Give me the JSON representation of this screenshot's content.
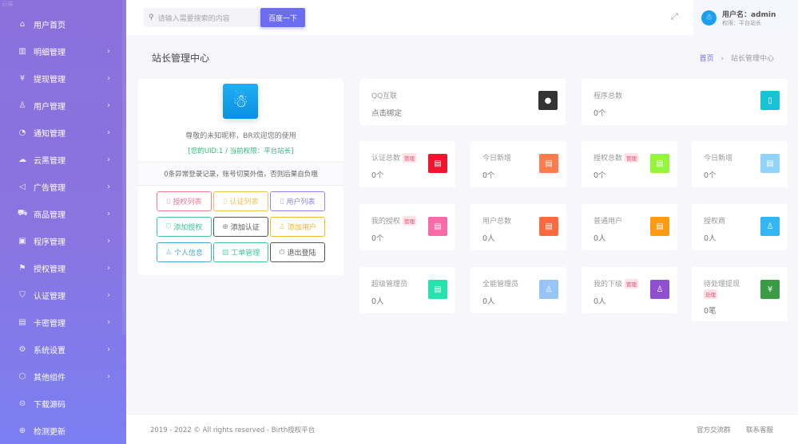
{
  "brand": "云端",
  "sidebar": {
    "items": [
      {
        "label": "用户首页",
        "icon": "home-icon",
        "glyph": "⌂",
        "chev": false
      },
      {
        "label": "明细管理",
        "icon": "list-icon",
        "glyph": "▥",
        "chev": true
      },
      {
        "label": "提现管理",
        "icon": "yen-icon",
        "glyph": "¥",
        "chev": true
      },
      {
        "label": "用户管理",
        "icon": "user-icon",
        "glyph": "♙",
        "chev": true
      },
      {
        "label": "通知管理",
        "icon": "bell-icon",
        "glyph": "◔",
        "chev": true
      },
      {
        "label": "云黑管理",
        "icon": "cloud-icon",
        "glyph": "☁",
        "chev": true
      },
      {
        "label": "广告管理",
        "icon": "megaphone-icon",
        "glyph": "◁",
        "chev": true
      },
      {
        "label": "商品管理",
        "icon": "cart-icon",
        "glyph": "⛟",
        "chev": true
      },
      {
        "label": "程序管理",
        "icon": "app-icon",
        "glyph": "▣",
        "chev": true
      },
      {
        "label": "授权管理",
        "icon": "flag-icon",
        "glyph": "⚑",
        "chev": true
      },
      {
        "label": "认证管理",
        "icon": "shield-icon",
        "glyph": "⛉",
        "chev": true
      },
      {
        "label": "卡密管理",
        "icon": "card-icon",
        "glyph": "▤",
        "chev": true
      },
      {
        "label": "系统设置",
        "icon": "gear-icon",
        "glyph": "⚙",
        "chev": true
      },
      {
        "label": "其他组件",
        "icon": "box-icon",
        "glyph": "⬡",
        "chev": true
      },
      {
        "label": "下载源码",
        "icon": "download-icon",
        "glyph": "⊝",
        "chev": false
      },
      {
        "label": "检测更新",
        "icon": "refresh-icon",
        "glyph": "⊕",
        "chev": false
      }
    ]
  },
  "topbar": {
    "search_placeholder": "请输入需要搜索的内容",
    "search_button": "百度一下",
    "user_name": "用户名：admin",
    "user_role": "权限：平台站长"
  },
  "page": {
    "title": "站长管理中心",
    "breadcrumb_home": "首页",
    "breadcrumb_sep": "›",
    "breadcrumb_current": "站长管理中心"
  },
  "profile": {
    "welcome": "尊敬的未知昵称，BR欢迎您的使用",
    "uid_line": "[您的UID:1 / 当前权限：平台站长]",
    "notice": "0条异常登录记录，账号切莫外借，否则后果自负哦",
    "buttons": [
      {
        "label": "授权列表",
        "icon": "file-icon",
        "glyph": "▯",
        "color": "#f07c95"
      },
      {
        "label": "认证列表",
        "icon": "file-icon",
        "glyph": "▯",
        "color": "#f5c04a"
      },
      {
        "label": "用户列表",
        "icon": "file-icon",
        "glyph": "▯",
        "color": "#8f86ee"
      },
      {
        "label": "添加授权",
        "icon": "shield-check-icon",
        "glyph": "⛉",
        "color": "#3cc49a"
      },
      {
        "label": "添加认证",
        "icon": "plus-circle-icon",
        "glyph": "⊕",
        "color": "#555555"
      },
      {
        "label": "添加用户",
        "icon": "user-icon",
        "glyph": "♙",
        "color": "#f5b52e"
      },
      {
        "label": "个人信息",
        "icon": "user-icon",
        "glyph": "♙",
        "color": "#4aa6d6"
      },
      {
        "label": "工单管理",
        "icon": "ticket-icon",
        "glyph": "▨",
        "color": "#3cc49a"
      },
      {
        "label": "退出登陆",
        "icon": "power-icon",
        "glyph": "⏻",
        "color": "#555555"
      }
    ]
  },
  "cards": [
    {
      "title": "QQ互联",
      "value": "点击绑定",
      "icon": "qq-icon",
      "glyph": "●",
      "color": "#333333",
      "tag": ""
    },
    {
      "title": "程序总数",
      "value": "0个",
      "icon": "phone-icon",
      "glyph": "▯",
      "color": "#17c3d4",
      "tag": ""
    },
    {
      "title": "认证总数",
      "value": "0个",
      "icon": "file-icon",
      "glyph": "▤",
      "color": "#f0142f",
      "tag": "管理"
    },
    {
      "title": "今日新增",
      "value": "0个",
      "icon": "file-icon",
      "glyph": "▤",
      "color": "#fb7c4c",
      "tag": ""
    },
    {
      "title": "授权总数",
      "value": "0个",
      "icon": "file-icon",
      "glyph": "▤",
      "color": "#94f53a",
      "tag": "管理"
    },
    {
      "title": "今日新增",
      "value": "0个",
      "icon": "file-icon",
      "glyph": "▤",
      "color": "#8fd3fa",
      "tag": ""
    },
    {
      "title": "我的授权",
      "value": "0个",
      "icon": "file-icon",
      "glyph": "▤",
      "color": "#f86aa8",
      "tag": "管理"
    },
    {
      "title": "用户总数",
      "value": "0人",
      "icon": "file-icon",
      "glyph": "▤",
      "color": "#fa6a3e",
      "tag": ""
    },
    {
      "title": "普通用户",
      "value": "0人",
      "icon": "file-icon",
      "glyph": "▤",
      "color": "#fc9a10",
      "tag": ""
    },
    {
      "title": "授权商",
      "value": "0人",
      "icon": "users-icon",
      "glyph": "♙",
      "color": "#33b6f4",
      "tag": ""
    },
    {
      "title": "超级管理员",
      "value": "0人",
      "icon": "file-icon",
      "glyph": "▤",
      "color": "#24e3ad",
      "tag": ""
    },
    {
      "title": "全能管理员",
      "value": "0人",
      "icon": "users-icon",
      "glyph": "♙",
      "color": "#98c4fa",
      "tag": ""
    },
    {
      "title": "我的下级",
      "value": "0人",
      "icon": "users-icon",
      "glyph": "♙",
      "color": "#8f4fd0",
      "tag": "管理"
    },
    {
      "title": "待处理提现",
      "value": "0笔",
      "icon": "yen-icon",
      "glyph": "¥",
      "color": "#3a9a45",
      "tag": "处理"
    }
  ],
  "footer": {
    "copyright": "2019 - 2022 © All rights reserved - Birth授权平台",
    "link1": "官方交流群",
    "link2": "联系客服"
  }
}
